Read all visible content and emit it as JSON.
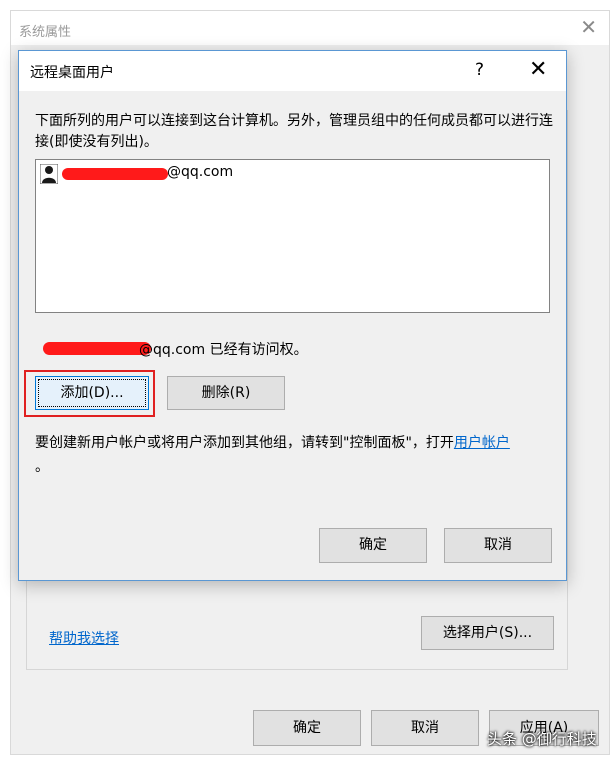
{
  "system_window": {
    "title": "系统属性",
    "help_link": "帮助我选择",
    "select_users_button": "选择用户(S)...",
    "ok_button": "确定",
    "cancel_button": "取消",
    "apply_button": "应用(A)"
  },
  "dialog": {
    "title": "远程桌面用户",
    "help_button": "?",
    "description": "下面所列的用户可以连接到这台计算机。另外，管理员组中的任何成员都可以进行连接(即使没有列出)。",
    "users": [
      {
        "email_suffix": "@qq.com",
        "icon": "user-icon"
      }
    ],
    "access_suffix": "@qq.com 已经有访问权。",
    "add_button": "添加(D)...",
    "remove_button": "删除(R)",
    "note_text": "要创建新用户帐户或将用户添加到其他组，请转到\"控制面板\"，打开",
    "note_link": "用户帐户",
    "note_end": "。",
    "ok_button": "确定",
    "cancel_button": "取消"
  },
  "colors": {
    "redaction": "#ff1a1a",
    "highlight": "#e02020",
    "link": "#0066cc"
  },
  "watermark": "头条 @御行科技"
}
